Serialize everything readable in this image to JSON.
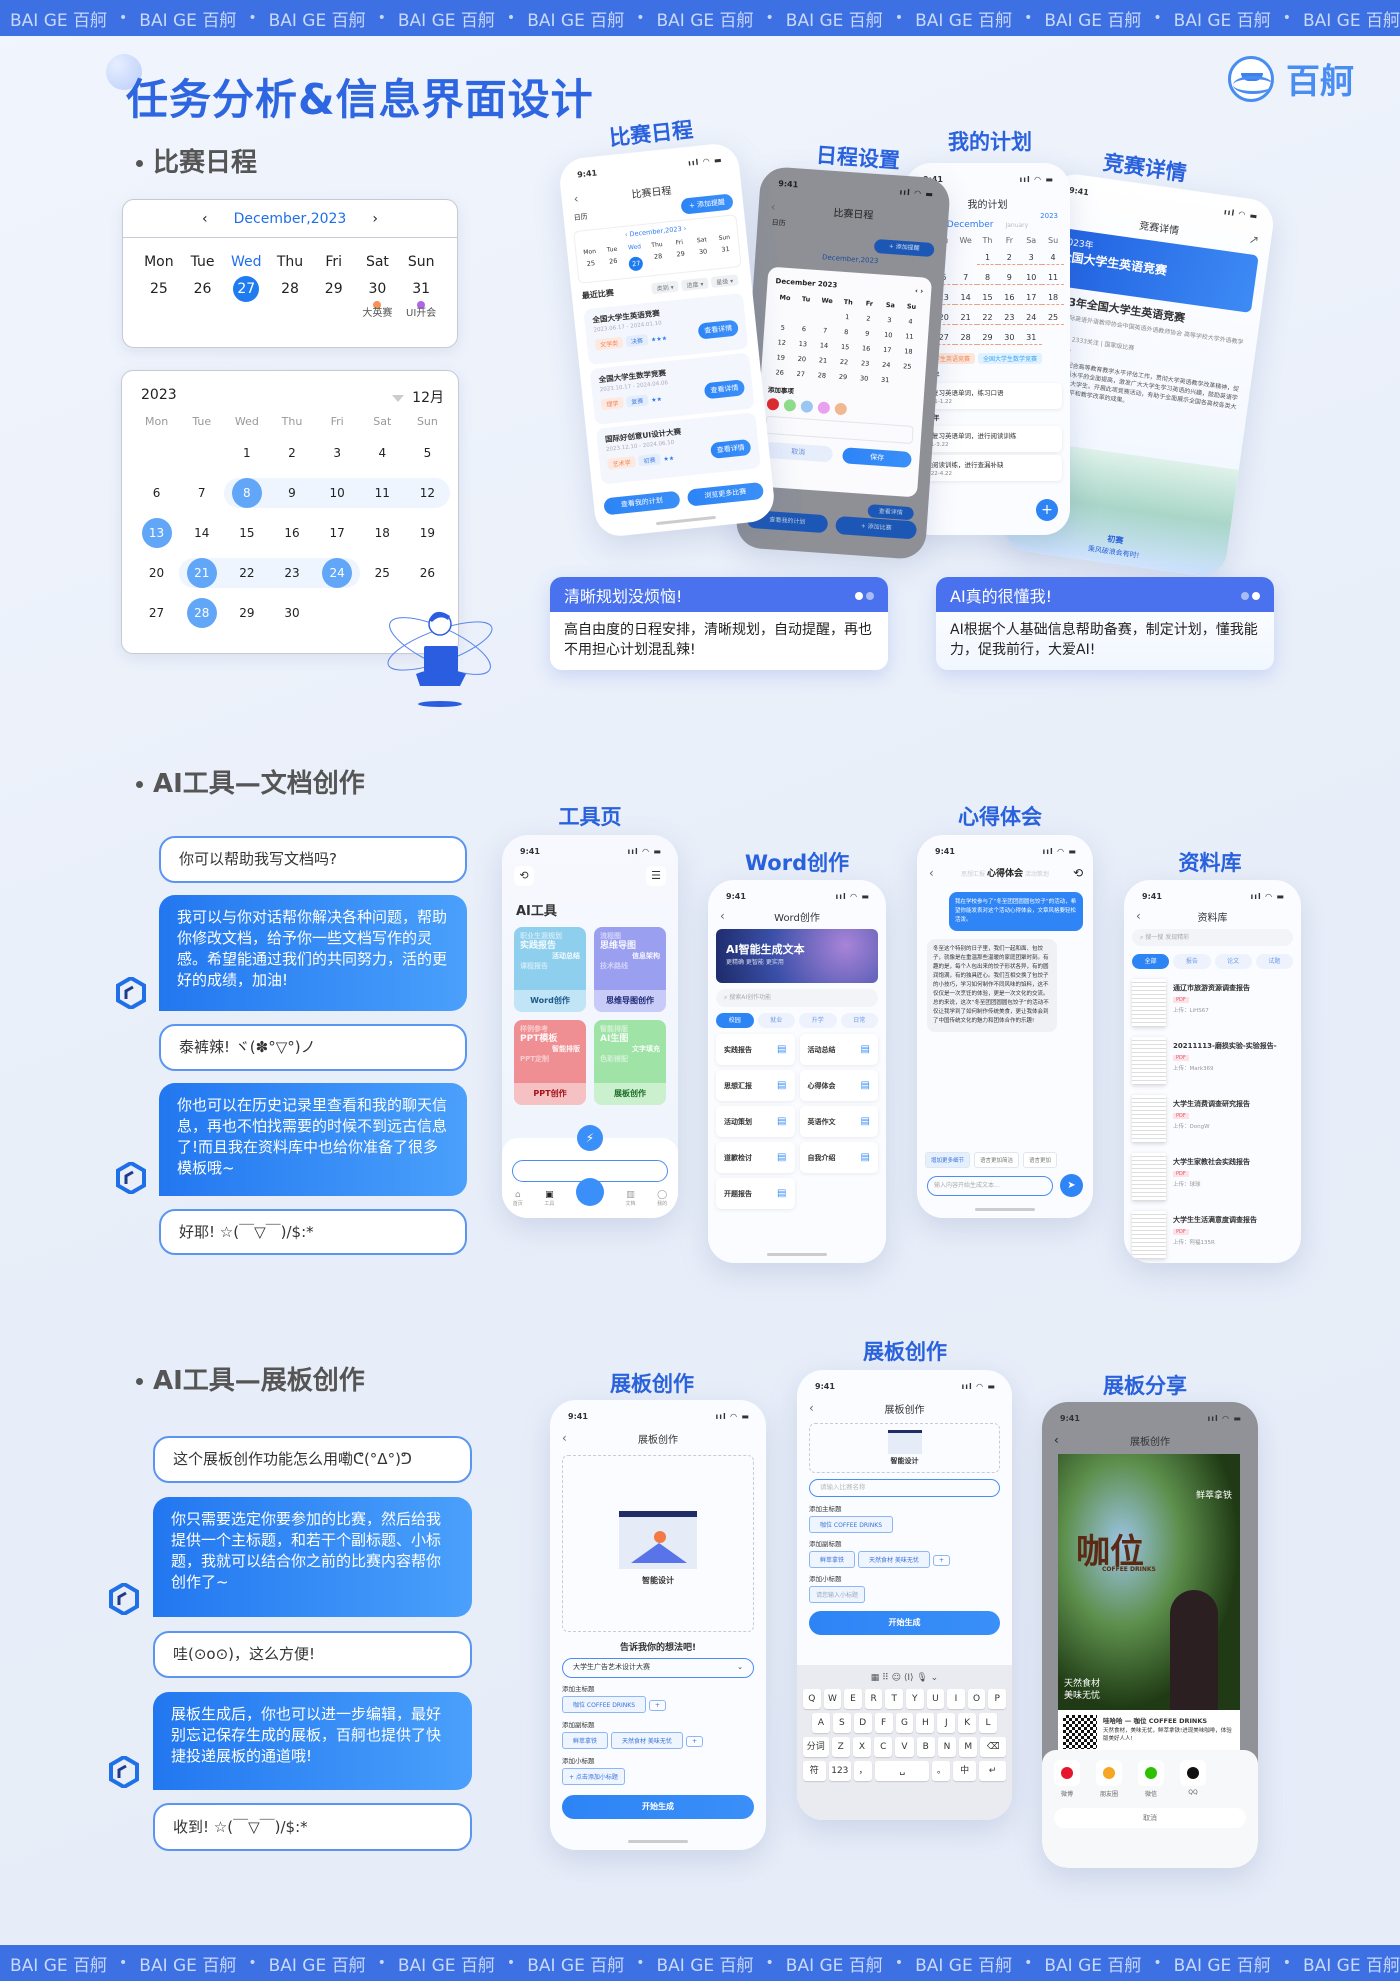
{
  "banner": {
    "item": "BAI GE 百舸",
    "sep": "•"
  },
  "header": {
    "title": "任务分析&信息界面设计",
    "logo_text": "百舸"
  },
  "colors": {
    "primary": "#2f6fe8",
    "banner": "#3d70e2",
    "bubble": "#2b83f3"
  },
  "section1": {
    "heading": "比赛日程",
    "calendar_week": {
      "month": "December,2023",
      "weekdays": [
        "Mon",
        "Tue",
        "Wed",
        "Thu",
        "Fri",
        "Sat",
        "Sun"
      ],
      "dates": [
        "25",
        "26",
        "27",
        "28",
        "29",
        "30",
        "31"
      ],
      "today": "27",
      "events": [
        {
          "date": "30",
          "label": "大英赛",
          "color": "#f6915a"
        },
        {
          "date": "31",
          "label": "UI开会",
          "color": "#b065e8"
        }
      ]
    },
    "calendar_month": {
      "year": "2023",
      "month": "12月",
      "weekdays": [
        "Mon",
        "Tue",
        "Wed",
        "Thu",
        "Fri",
        "Sat",
        "Sun"
      ],
      "days": [
        "",
        "",
        "1",
        "2",
        "3",
        "4",
        "5",
        "6",
        "7",
        "8",
        "9",
        "10",
        "11",
        "12",
        "13",
        "14",
        "15",
        "16",
        "17",
        "18",
        "19",
        "20",
        "21",
        "22",
        "23",
        "24",
        "25",
        "26",
        "27",
        "28",
        "29",
        "30",
        "",
        "",
        ""
      ],
      "selected": [
        "8",
        "13",
        "21",
        "24",
        "28"
      ],
      "ranges": [
        [
          "8",
          "12"
        ],
        [
          "21",
          "24"
        ]
      ]
    },
    "phones": {
      "schedule": {
        "label": "比赛日程",
        "time": "9:41",
        "title": "比赛日程",
        "add": "+ 添加提醒",
        "cal_label": "日历",
        "month": "December,2023",
        "weekdays": [
          "Mon",
          "Tue",
          "Wed",
          "Thu",
          "Fri",
          "Sat",
          "Sun"
        ],
        "dates": [
          "25",
          "26",
          "27",
          "28",
          "29",
          "30",
          "31"
        ],
        "recent": "最近比赛",
        "filters": [
          "类别 ▾",
          "进度 ▾",
          "星级 ▾"
        ],
        "contests": [
          {
            "name": "全国大学生英语竞赛",
            "dates": "2023.06.17 - 2024.01.10",
            "tags": [
              "文学类",
              "决赛"
            ],
            "stars": "★★★"
          },
          {
            "name": "全国大学生数学竞赛",
            "dates": "2023.10.17 - 2024.04.06",
            "tags": [
              "理学",
              "复赛"
            ],
            "stars": "★★"
          },
          {
            "name": "国际好创意UI设计大赛",
            "dates": "2023.12.10 - 2024.06.10",
            "tags": [
              "艺术学",
              "初赛"
            ],
            "stars": "★★"
          }
        ],
        "detail_btn": "查看详情",
        "btn_plan": "查看我的计划",
        "btn_more": "浏览更多比赛"
      },
      "settings": {
        "label": "日程设置",
        "time": "9:41",
        "title": "比赛日程",
        "cal_label": "日历",
        "add": "+ 添加提醒",
        "month": "December,2023",
        "modal_month": "December 2023",
        "weekdays": [
          "Mo",
          "Tu",
          "We",
          "Th",
          "Fr",
          "Sa",
          "Su"
        ],
        "days": [
          "",
          "",
          "",
          "1",
          "2",
          "3",
          "4",
          "5",
          "6",
          "7",
          "8",
          "9",
          "10",
          "11",
          "12",
          "13",
          "14",
          "15",
          "16",
          "17",
          "18",
          "19",
          "20",
          "21",
          "22",
          "23",
          "24",
          "25",
          "26",
          "27",
          "28",
          "29",
          "30",
          "31",
          ""
        ],
        "add_item": "添加事项",
        "swatches": [
          "#e02a2a",
          "#8fdc8a",
          "#9cc6f2",
          "#e9a0ef",
          "#f0b790"
        ],
        "cancel": "取消",
        "save": "保存",
        "detail_btn": "查看详情",
        "btn_plan": "查看我的计划",
        "btn_add": "+ 添加比赛"
      },
      "plan": {
        "label": "我的计划",
        "time": "9:41",
        "title": "我的计划",
        "year": "2023",
        "month": "December",
        "next_month": "January",
        "weekdays": [
          "Mo",
          "Tu",
          "We",
          "Th",
          "Fr",
          "Sa",
          "Su"
        ],
        "days": [
          "",
          "",
          "",
          "1",
          "2",
          "3",
          "4",
          "5",
          "6",
          "7",
          "8",
          "9",
          "10",
          "11",
          "12",
          "13",
          "14",
          "15",
          "16",
          "17",
          "18",
          "19",
          "20",
          "21",
          "22",
          "23",
          "24",
          "25",
          "26",
          "27",
          "28",
          "29",
          "30",
          "31",
          ""
        ],
        "chips": [
          "全国大学生英语竞赛",
          "全国大学生数学竞赛"
        ],
        "groups": [
          {
            "year": "2023年",
            "items": [
              {
                "text": "提前复习英语单词，练习口语",
                "date": "12.1-1.22"
              }
            ]
          },
          {
            "year": "2024年",
            "items": [
              {
                "text": "继续复习英语单词，进行阅读训练",
                "date": "2.1-3.22"
              },
              {
                "text": "继续阅读训练，进行查漏补缺",
                "date": "3.22-4.22"
              }
            ]
          }
        ]
      },
      "detail": {
        "label": "竞赛详情",
        "time": "9:41",
        "title": "竞赛详情",
        "banner_year": "2023年",
        "banner_title": "全国大学生英语竞赛",
        "heading": "2023年全国大学生英语竞赛",
        "organizer": "主办方 国际英语外语教师协会中国英语外语教师协会 高等学校大学外语教学研究会",
        "stats": "10万浏览 | 2333关注 | 国家级比赛",
        "intro_title": "竞赛介绍",
        "intro": "本竞赛旨在配合高等教育教学水平评估工作，贯彻大学英语教学改革精神，促进大学生英语水平的全面提高，激发广大大学生学习英语的兴趣，鼓励英语学习成绩优秀的大学生。开展此项竞赛活动，有助于全面展示全国各高校各类大学英语教学水平和教学改革的成果。",
        "stage": "初赛",
        "slogan": "乘风破浪会有时!"
      }
    },
    "cards": [
      {
        "title": "清晰规划没烦恼!",
        "body": "高自由度的日程安排，清晰规划，自动提醒，再也不用担心计划混乱辣!"
      },
      {
        "title": "AI真的很懂我!",
        "body": "AI根据个人基础信息帮助备赛，制定计划，懂我能力，促我前行，大爱AI!"
      }
    ]
  },
  "section2": {
    "heading": "AI工具—文档创作",
    "chat": [
      {
        "role": "user",
        "text": "你可以帮助我写文档吗?"
      },
      {
        "role": "ai",
        "text": "我可以与你对话帮你解决各种问题，帮助你修改文档，给予你一些文档写作的灵感。希望能通过我们的共同努力，活的更好的成绩，加油!"
      },
      {
        "role": "user",
        "text": "泰裤辣! ヾ(✽°▽°)ノ"
      },
      {
        "role": "ai",
        "text": "你也可以在历史记录里查看和我的聊天信息，再也不怕找需要的时候不到远古信息了!而且我在资料库中也给你准备了很多模板哦~"
      },
      {
        "role": "user",
        "text": "好耶! ☆(￣▽￣)/$:*"
      }
    ],
    "phones": {
      "tools": {
        "label": "工具页",
        "time": "9:41",
        "title": "AI工具",
        "tiles": [
          {
            "lines": [
              "职业生涯规划",
              "实践报告",
              "活动总结",
              "课程报告"
            ],
            "name": "Word创作",
            "bg": "#8fcfee",
            "fg": "#1b5a8a"
          },
          {
            "lines": [
              "流程图",
              "思维导图",
              "信息架构",
              "技术路线"
            ],
            "name": "思维导图创作",
            "bg": "#9b9ff0",
            "fg": "#1e2a78"
          },
          {
            "lines": [
              "样例参考",
              "PPT模板",
              "智能排版",
              "PPT定制"
            ],
            "name": "PPT创作",
            "bg": "#ef8f93",
            "fg": "#a3121c"
          },
          {
            "lines": [
              "智能排版",
              "AI生图",
              "文字填充",
              "色彩搭配"
            ],
            "name": "展板创作",
            "bg": "#9fe3a6",
            "fg": "#1b6e25"
          }
        ],
        "tabs": [
          "首页",
          "工具",
          "",
          "文档",
          "我的"
        ]
      },
      "word": {
        "label": "Word创作",
        "time": "9:41",
        "title": "Word创作",
        "hero_title": "AI智能生成文本",
        "hero_sub": "更精确 更智能 更实用",
        "search_placeholder": "搜索AI创作功能",
        "cats": [
          "校园",
          "就业",
          "升学",
          "日常"
        ],
        "items": [
          "实践报告",
          "活动总结",
          "思想汇报",
          "心得体会",
          "活动策划",
          "英语作文",
          "道歉检讨",
          "自我介绍",
          "开题报告"
        ]
      },
      "reflection": {
        "label": "心得体会",
        "time": "9:41",
        "tabs": [
          "思想汇报",
          "心得体会",
          "活动策划"
        ],
        "user_msg": "我在学校参与了“冬至团团圆圆包饺子”的活动，希望你能发表对这个活动心得体会，文章风格要轻松活泼。",
        "ai_msg": "冬至这个特别的日子里，我们一起和面、包饺子，就像是在重温那些温暖的家庭团聚时刻。有趣的是，每个人包出来的饺子形状各异，有的圆润饱满，有的独具匠心。我们互相交换了包饺子的小技巧，学习如何制作不同风味的馅料，这不仅仅是一次烹饪的体验，更是一次文化的交流。总的来说，这次“冬至团团圆圆包饺子”的活动不仅让我学到了如何制作传统美食，更让我体会到了中国传统文化的魅力和团体合作的乐趣!",
        "actions": [
          "增加更多细节",
          "语言更加简洁",
          "语言更加"
        ],
        "input_placeholder": "输入内容开始生成文本..."
      },
      "library": {
        "label": "资料库",
        "time": "9:41",
        "title": "资料库",
        "search_placeholder": "搜一搜 发现精彩",
        "cats": [
          "全部",
          "报告",
          "论文",
          "试题"
        ],
        "docs": [
          {
            "name": "通辽市旅游资源调查报告",
            "type": "PDF",
            "uploader": "上传：LiHS67"
          },
          {
            "name": "20211113-磨损实验-实验报告-",
            "type": "PDF",
            "uploader": "上传：Mark369"
          },
          {
            "name": "大学生消费调查研究报告",
            "type": "PDF",
            "uploader": "上传：DongW"
          },
          {
            "name": "大学生家教社会实践报告",
            "type": "PDF",
            "uploader": "上传：球球"
          },
          {
            "name": "大学生生活满意度调查报告",
            "type": "PDF",
            "uploader": "上传：阿福135R"
          }
        ]
      }
    }
  },
  "section3": {
    "heading": "AI工具—展板创作",
    "chat": [
      {
        "role": "user",
        "text": "这个展板创作功能怎么用嘞ᕦ(°Δ°)ᕤ"
      },
      {
        "role": "ai",
        "text": "你只需要选定你要参加的比赛，然后给我提供一个主标题，和若干个副标题、小标题，我就可以结合你之前的比赛内容帮你创作了~"
      },
      {
        "role": "user",
        "text": "哇(⊙o⊙)，这么方便!"
      },
      {
        "role": "ai",
        "text": "展板生成后，你也可以进一步编辑，最好别忘记保存生成的展板，百舸也提供了快捷投递展板的通道哦!"
      },
      {
        "role": "user",
        "text": "收到! ☆(￣▽￣)/$:*"
      }
    ],
    "phones": {
      "board1": {
        "label": "展板创作",
        "time": "9:41",
        "title": "展板创作",
        "smart": "智能设计",
        "prompt": "告诉我你的想法吧!",
        "contest": "大学生广告艺术设计大赛",
        "main_label": "添加主标题",
        "main": [
          "咖位 COFFEE DRINKS"
        ],
        "sub_label": "添加副标题",
        "subs": [
          "鲜萃拿铁",
          "天然食材 美味无忧"
        ],
        "small_label": "添加小标题",
        "small_add": "+ 点击添加小标题",
        "generate": "开始生成"
      },
      "board2": {
        "label": "展板创作",
        "time": "9:41",
        "title": "展板创作",
        "smart": "智能设计",
        "contest_placeholder": "请输入比赛名称",
        "main_label": "添加主标题",
        "main": [
          "咖位 COFFEE DRINKS"
        ],
        "sub_label": "添加副标题",
        "subs": [
          "鲜萃拿铁",
          "天然食材 美味无忧"
        ],
        "small_label": "添加小标题",
        "small_placeholder": "请您输入小标题",
        "generate": "开始生成",
        "keys_row1": [
          "Q",
          "W",
          "E",
          "R",
          "T",
          "Y",
          "U",
          "I",
          "O",
          "P"
        ],
        "keys_row2": [
          "A",
          "S",
          "D",
          "F",
          "G",
          "H",
          "J",
          "K",
          "L"
        ],
        "keys_row3": [
          "分词",
          "Z",
          "X",
          "C",
          "V",
          "B",
          "N",
          "M",
          "⌫"
        ],
        "keys_row4": [
          "符",
          "123",
          "，",
          "␣",
          "。",
          "中",
          "↵"
        ]
      },
      "share": {
        "label": "展板分享",
        "time": "9:41",
        "title": "展板创作",
        "poster_brand": "咖位",
        "poster_en": "COFFEE DRINKS",
        "poster_sub": "鲜萃拿铁",
        "poster_bottom": "天然食材\n美味无忧",
        "card_title": "哇哈哈 — 咖位 COFFEE DRINKS",
        "card_text": "天然食材，美味无忧，鲜萃拿铁!进现美味咖啡，体验版美好人人!",
        "share_targets": [
          {
            "name": "微博",
            "color": "#e6162d"
          },
          {
            "name": "朋友圈",
            "color": "#f5a623"
          },
          {
            "name": "微信",
            "color": "#2dc100"
          },
          {
            "name": "QQ",
            "color": "#111111"
          }
        ],
        "cancel": "取消"
      }
    }
  }
}
